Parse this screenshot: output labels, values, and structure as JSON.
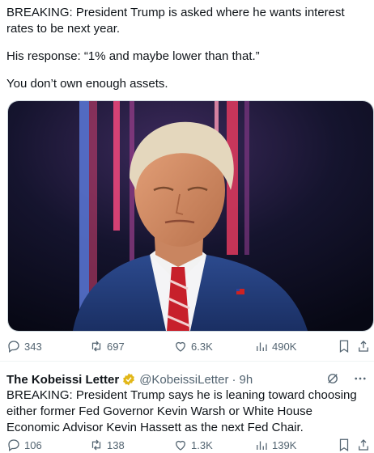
{
  "tweet1": {
    "text_lines": [
      "BREAKING: President Trump is asked where he wants interest rates to be next year.",
      "His response: “1% and maybe lower than that.”",
      "You don’t own enough assets."
    ],
    "media_icon": "photo-of-man-in-suit",
    "stats": {
      "replies": "343",
      "reposts": "697",
      "likes": "6.3K",
      "views": "490K"
    }
  },
  "tweet2": {
    "author_name": "The Kobeissi Letter",
    "handle": "@KobeissiLetter",
    "separator": "·",
    "time": "9h",
    "text": "BREAKING: President Trump says he is leaning toward choosing either former Fed Governor Kevin Warsh or White House Economic Advisor Kevin Hassett as the next Fed Chair.",
    "stats": {
      "replies": "106",
      "reposts": "138",
      "likes": "1.3K",
      "views": "139K"
    }
  },
  "colors": {
    "text": "#0f1419",
    "muted": "#536471",
    "verified": "#e2b719"
  }
}
